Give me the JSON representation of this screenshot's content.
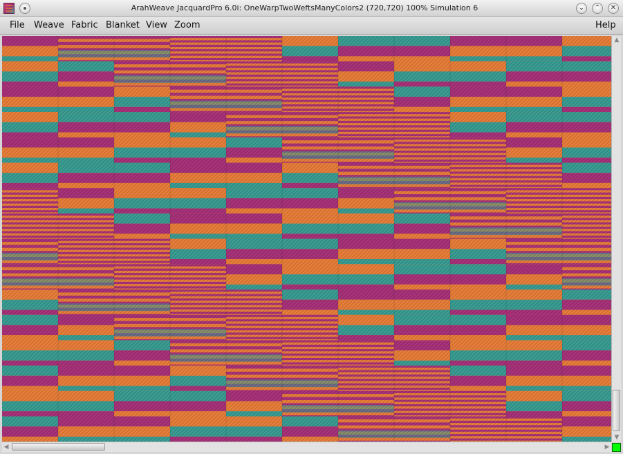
{
  "window": {
    "title": "ArahWeave JacquardPro 6.0i: OneWarpTwoWeftsManyColors2 (720,720) 100% Simulation 6",
    "minimize_glyph": "⌄",
    "maximize_glyph": "⌃",
    "close_glyph": "✕"
  },
  "menubar": {
    "items": [
      "File",
      "Weave",
      "Fabric",
      "Blanket",
      "View",
      "Zoom"
    ],
    "help": "Help"
  },
  "scrollbars": {
    "up_glyph": "▲",
    "down_glyph": "▼",
    "left_glyph": "◀",
    "right_glyph": "▶"
  },
  "fabric": {
    "colors": {
      "magenta": "#a8327a",
      "orange": "#e87e3a",
      "teal": "#3a9d93"
    },
    "fine_stripe_pattern": "#a8327a/#e87e3a alternating"
  },
  "status": {
    "indicator_color": "#00ff00"
  }
}
